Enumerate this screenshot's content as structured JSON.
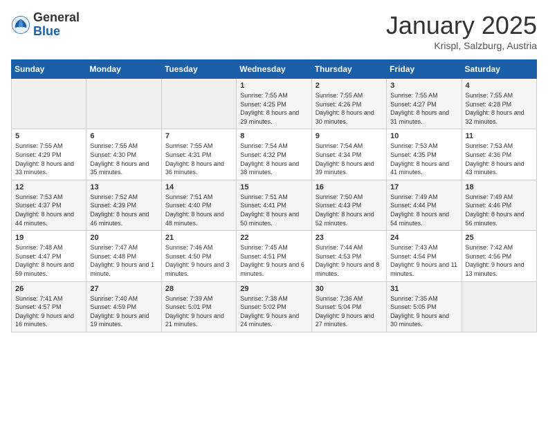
{
  "logo": {
    "general": "General",
    "blue": "Blue"
  },
  "title": {
    "month": "January 2025",
    "location": "Krispl, Salzburg, Austria"
  },
  "weekdays": [
    "Sunday",
    "Monday",
    "Tuesday",
    "Wednesday",
    "Thursday",
    "Friday",
    "Saturday"
  ],
  "weeks": [
    [
      {
        "day": "",
        "sunrise": "",
        "sunset": "",
        "daylight": ""
      },
      {
        "day": "",
        "sunrise": "",
        "sunset": "",
        "daylight": ""
      },
      {
        "day": "",
        "sunrise": "",
        "sunset": "",
        "daylight": ""
      },
      {
        "day": "1",
        "sunrise": "Sunrise: 7:55 AM",
        "sunset": "Sunset: 4:25 PM",
        "daylight": "Daylight: 8 hours and 29 minutes."
      },
      {
        "day": "2",
        "sunrise": "Sunrise: 7:55 AM",
        "sunset": "Sunset: 4:26 PM",
        "daylight": "Daylight: 8 hours and 30 minutes."
      },
      {
        "day": "3",
        "sunrise": "Sunrise: 7:55 AM",
        "sunset": "Sunset: 4:27 PM",
        "daylight": "Daylight: 8 hours and 31 minutes."
      },
      {
        "day": "4",
        "sunrise": "Sunrise: 7:55 AM",
        "sunset": "Sunset: 4:28 PM",
        "daylight": "Daylight: 8 hours and 32 minutes."
      }
    ],
    [
      {
        "day": "5",
        "sunrise": "Sunrise: 7:55 AM",
        "sunset": "Sunset: 4:29 PM",
        "daylight": "Daylight: 8 hours and 33 minutes."
      },
      {
        "day": "6",
        "sunrise": "Sunrise: 7:55 AM",
        "sunset": "Sunset: 4:30 PM",
        "daylight": "Daylight: 8 hours and 35 minutes."
      },
      {
        "day": "7",
        "sunrise": "Sunrise: 7:55 AM",
        "sunset": "Sunset: 4:31 PM",
        "daylight": "Daylight: 8 hours and 36 minutes."
      },
      {
        "day": "8",
        "sunrise": "Sunrise: 7:54 AM",
        "sunset": "Sunset: 4:32 PM",
        "daylight": "Daylight: 8 hours and 38 minutes."
      },
      {
        "day": "9",
        "sunrise": "Sunrise: 7:54 AM",
        "sunset": "Sunset: 4:34 PM",
        "daylight": "Daylight: 8 hours and 39 minutes."
      },
      {
        "day": "10",
        "sunrise": "Sunrise: 7:53 AM",
        "sunset": "Sunset: 4:35 PM",
        "daylight": "Daylight: 8 hours and 41 minutes."
      },
      {
        "day": "11",
        "sunrise": "Sunrise: 7:53 AM",
        "sunset": "Sunset: 4:36 PM",
        "daylight": "Daylight: 8 hours and 43 minutes."
      }
    ],
    [
      {
        "day": "12",
        "sunrise": "Sunrise: 7:53 AM",
        "sunset": "Sunset: 4:37 PM",
        "daylight": "Daylight: 8 hours and 44 minutes."
      },
      {
        "day": "13",
        "sunrise": "Sunrise: 7:52 AM",
        "sunset": "Sunset: 4:39 PM",
        "daylight": "Daylight: 8 hours and 46 minutes."
      },
      {
        "day": "14",
        "sunrise": "Sunrise: 7:51 AM",
        "sunset": "Sunset: 4:40 PM",
        "daylight": "Daylight: 8 hours and 48 minutes."
      },
      {
        "day": "15",
        "sunrise": "Sunrise: 7:51 AM",
        "sunset": "Sunset: 4:41 PM",
        "daylight": "Daylight: 8 hours and 50 minutes."
      },
      {
        "day": "16",
        "sunrise": "Sunrise: 7:50 AM",
        "sunset": "Sunset: 4:43 PM",
        "daylight": "Daylight: 8 hours and 52 minutes."
      },
      {
        "day": "17",
        "sunrise": "Sunrise: 7:49 AM",
        "sunset": "Sunset: 4:44 PM",
        "daylight": "Daylight: 8 hours and 54 minutes."
      },
      {
        "day": "18",
        "sunrise": "Sunrise: 7:49 AM",
        "sunset": "Sunset: 4:46 PM",
        "daylight": "Daylight: 8 hours and 56 minutes."
      }
    ],
    [
      {
        "day": "19",
        "sunrise": "Sunrise: 7:48 AM",
        "sunset": "Sunset: 4:47 PM",
        "daylight": "Daylight: 8 hours and 59 minutes."
      },
      {
        "day": "20",
        "sunrise": "Sunrise: 7:47 AM",
        "sunset": "Sunset: 4:48 PM",
        "daylight": "Daylight: 9 hours and 1 minute."
      },
      {
        "day": "21",
        "sunrise": "Sunrise: 7:46 AM",
        "sunset": "Sunset: 4:50 PM",
        "daylight": "Daylight: 9 hours and 3 minutes."
      },
      {
        "day": "22",
        "sunrise": "Sunrise: 7:45 AM",
        "sunset": "Sunset: 4:51 PM",
        "daylight": "Daylight: 9 hours and 6 minutes."
      },
      {
        "day": "23",
        "sunrise": "Sunrise: 7:44 AM",
        "sunset": "Sunset: 4:53 PM",
        "daylight": "Daylight: 9 hours and 8 minutes."
      },
      {
        "day": "24",
        "sunrise": "Sunrise: 7:43 AM",
        "sunset": "Sunset: 4:54 PM",
        "daylight": "Daylight: 9 hours and 11 minutes."
      },
      {
        "day": "25",
        "sunrise": "Sunrise: 7:42 AM",
        "sunset": "Sunset: 4:56 PM",
        "daylight": "Daylight: 9 hours and 13 minutes."
      }
    ],
    [
      {
        "day": "26",
        "sunrise": "Sunrise: 7:41 AM",
        "sunset": "Sunset: 4:57 PM",
        "daylight": "Daylight: 9 hours and 16 minutes."
      },
      {
        "day": "27",
        "sunrise": "Sunrise: 7:40 AM",
        "sunset": "Sunset: 4:59 PM",
        "daylight": "Daylight: 9 hours and 19 minutes."
      },
      {
        "day": "28",
        "sunrise": "Sunrise: 7:39 AM",
        "sunset": "Sunset: 5:01 PM",
        "daylight": "Daylight: 9 hours and 21 minutes."
      },
      {
        "day": "29",
        "sunrise": "Sunrise: 7:38 AM",
        "sunset": "Sunset: 5:02 PM",
        "daylight": "Daylight: 9 hours and 24 minutes."
      },
      {
        "day": "30",
        "sunrise": "Sunrise: 7:36 AM",
        "sunset": "Sunset: 5:04 PM",
        "daylight": "Daylight: 9 hours and 27 minutes."
      },
      {
        "day": "31",
        "sunrise": "Sunrise: 7:35 AM",
        "sunset": "Sunset: 5:05 PM",
        "daylight": "Daylight: 9 hours and 30 minutes."
      },
      {
        "day": "",
        "sunrise": "",
        "sunset": "",
        "daylight": ""
      }
    ]
  ]
}
